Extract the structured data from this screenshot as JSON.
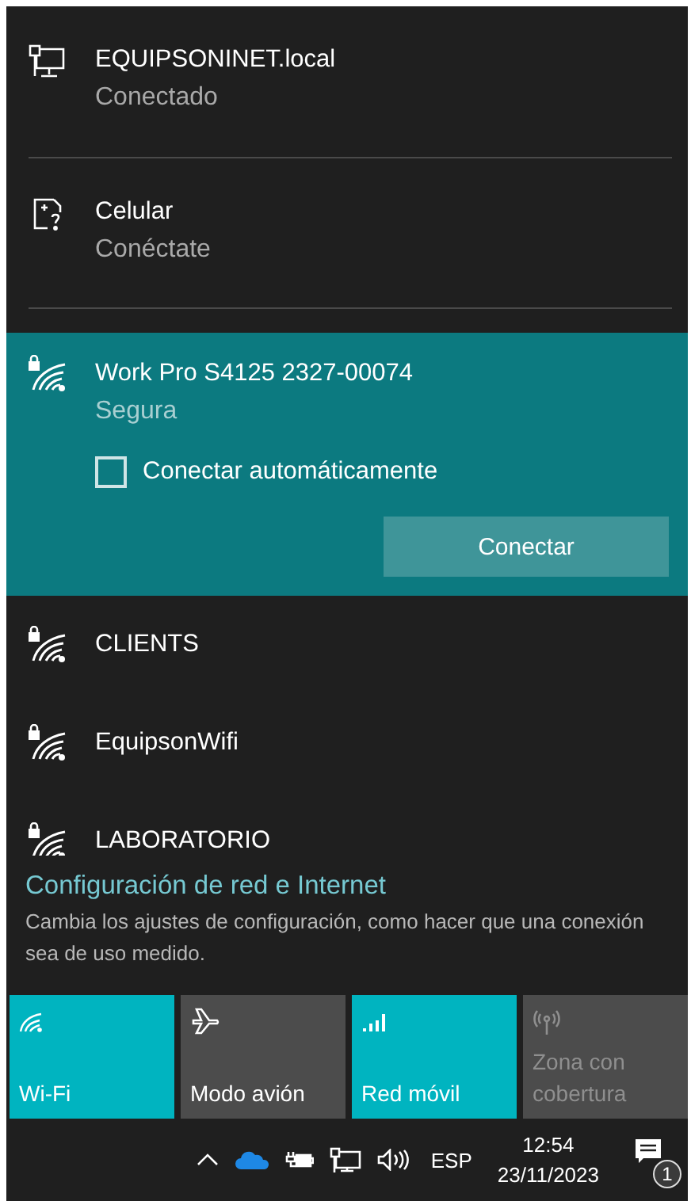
{
  "networks": [
    {
      "kind": "wired",
      "name": "EQUIPSONINET.local",
      "status": "Conectado",
      "selected": false
    },
    {
      "kind": "cellular",
      "name": "Celular",
      "status": "Conéctate",
      "selected": false
    },
    {
      "kind": "wifi",
      "name": "Work Pro S4125 2327-00074",
      "status": "Segura",
      "selected": true,
      "auto_connect": {
        "label": "Conectar automáticamente",
        "checked": false
      },
      "connect_button": "Conectar"
    },
    {
      "kind": "wifi",
      "name": "CLIENTS",
      "selected": false
    },
    {
      "kind": "wifi",
      "name": "EquipsonWifi",
      "selected": false
    },
    {
      "kind": "wifi",
      "name": "LABORATORIO",
      "selected": false
    }
  ],
  "settings": {
    "link": "Configuración de red e Internet",
    "description": "Cambia los ajustes de configuración, como hacer que una conexión sea de uso medido."
  },
  "quick_actions": [
    {
      "kind": "wifi",
      "label": "Wi-Fi",
      "on": true,
      "disabled": false
    },
    {
      "kind": "airplane",
      "label": "Modo avión",
      "on": false,
      "disabled": false
    },
    {
      "kind": "cellular",
      "label": "Red móvil",
      "on": true,
      "disabled": false
    },
    {
      "kind": "hotspot",
      "label": "Zona con cobertura",
      "on": false,
      "disabled": true
    }
  ],
  "taskbar": {
    "language": "ESP",
    "time": "12:54",
    "date": "23/11/2023",
    "notification_count": "1"
  }
}
